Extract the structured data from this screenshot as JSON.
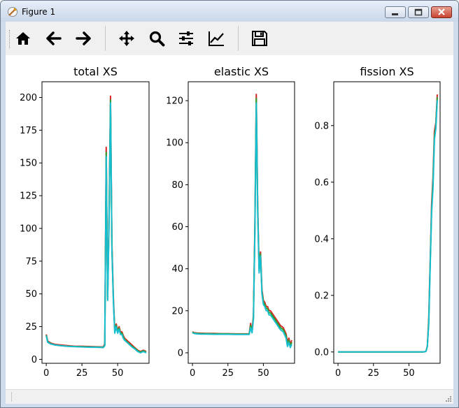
{
  "window": {
    "title": "Figure 1"
  },
  "toolbar": {
    "buttons": [
      {
        "name": "home-button",
        "icon": "home-icon"
      },
      {
        "name": "back-button",
        "icon": "arrow-left-icon"
      },
      {
        "name": "forward-button",
        "icon": "arrow-right-icon"
      },
      {
        "name": "pan-button",
        "icon": "move-icon"
      },
      {
        "name": "zoom-button",
        "icon": "magnifier-icon"
      },
      {
        "name": "configure-subplots-button",
        "icon": "sliders-icon"
      },
      {
        "name": "edit-axes-button",
        "icon": "line-chart-icon"
      },
      {
        "name": "save-button",
        "icon": "floppy-disk-icon"
      }
    ]
  },
  "chart_data": [
    {
      "type": "line",
      "title": "total XS",
      "xlabel": "",
      "ylabel": "",
      "xlim": [
        -3,
        72
      ],
      "ylim": [
        -3,
        212
      ],
      "xticks": [
        0,
        25,
        50
      ],
      "yticks": [
        0,
        25,
        50,
        75,
        100,
        125,
        150,
        175,
        200
      ],
      "grid": false,
      "series": [
        {
          "color": "#d62728",
          "x": [
            0,
            1,
            3,
            6,
            10,
            15,
            20,
            25,
            30,
            35,
            40,
            41,
            42,
            43,
            44,
            45,
            46,
            47,
            48,
            49,
            50,
            51,
            52,
            53,
            54,
            55,
            56,
            57,
            58,
            60,
            62,
            64,
            66,
            68,
            70
          ],
          "y": [
            19,
            14,
            12.5,
            11.5,
            11,
            10.5,
            10,
            10,
            9.8,
            9.6,
            9.5,
            12,
            162,
            48,
            110,
            201,
            88,
            48,
            22,
            27,
            22,
            25,
            21,
            21,
            18,
            16,
            15,
            14,
            13,
            11,
            9,
            7,
            6,
            7,
            6
          ]
        },
        {
          "color": "#2ca02c",
          "x": [
            0,
            1,
            3,
            6,
            10,
            15,
            20,
            25,
            30,
            35,
            40,
            41,
            42,
            43,
            44,
            45,
            46,
            47,
            48,
            49,
            50,
            51,
            52,
            53,
            54,
            55,
            56,
            57,
            58,
            60,
            62,
            64,
            66,
            68,
            70
          ],
          "y": [
            18.5,
            13.5,
            12,
            11,
            10.5,
            10,
            9.8,
            9.7,
            9.5,
            9.4,
            9.2,
            11,
            158,
            46,
            106,
            198,
            85,
            46,
            21,
            26,
            21,
            24,
            20,
            20,
            17,
            15,
            14,
            13,
            12,
            10,
            8.5,
            6.5,
            5.5,
            6.5,
            5.5
          ]
        },
        {
          "color": "#17becf",
          "x": [
            0,
            1,
            3,
            6,
            10,
            15,
            20,
            25,
            30,
            35,
            40,
            41,
            42,
            43,
            44,
            45,
            46,
            47,
            48,
            49,
            50,
            51,
            52,
            53,
            54,
            55,
            56,
            57,
            58,
            60,
            62,
            64,
            66,
            68,
            70
          ],
          "y": [
            18,
            13,
            11.8,
            11,
            10.5,
            10,
            9.7,
            9.5,
            9.3,
            9.2,
            9,
            10.5,
            155,
            45,
            104,
            196,
            84,
            45,
            20,
            25,
            20,
            23,
            19,
            19,
            16,
            14.5,
            13.5,
            12.5,
            11.5,
            9.5,
            8,
            6,
            5,
            6,
            5
          ]
        }
      ]
    },
    {
      "type": "line",
      "title": "elastic XS",
      "xlabel": "",
      "ylabel": "",
      "xlim": [
        -3,
        72
      ],
      "ylim": [
        -5,
        129
      ],
      "xticks": [
        0,
        25,
        50
      ],
      "yticks": [
        0,
        20,
        40,
        60,
        80,
        100,
        120
      ],
      "grid": false,
      "series": [
        {
          "color": "#d62728",
          "x": [
            0,
            1,
            3,
            6,
            10,
            15,
            20,
            25,
            30,
            35,
            40,
            41,
            42,
            43,
            44,
            45,
            46,
            47,
            48,
            49,
            50,
            51,
            52,
            53,
            54,
            55,
            56,
            57,
            58,
            60,
            62,
            64,
            66,
            67,
            68,
            69,
            70
          ],
          "y": [
            10,
            9.6,
            9.4,
            9.3,
            9.2,
            9.2,
            9.1,
            9.1,
            9,
            9,
            9,
            14,
            10,
            18,
            60,
            123,
            70,
            40,
            48,
            30,
            25,
            24,
            22,
            22,
            20,
            20,
            19,
            18,
            17,
            15,
            13,
            12,
            9,
            5,
            7,
            4,
            6
          ]
        },
        {
          "color": "#2ca02c",
          "x": [
            0,
            1,
            3,
            6,
            10,
            15,
            20,
            25,
            30,
            35,
            40,
            41,
            42,
            43,
            44,
            45,
            46,
            47,
            48,
            49,
            50,
            51,
            52,
            53,
            54,
            55,
            56,
            57,
            58,
            60,
            62,
            64,
            66,
            67,
            68,
            69,
            70
          ],
          "y": [
            9.8,
            9.4,
            9.2,
            9.1,
            9.1,
            9,
            9,
            9,
            8.9,
            8.9,
            8.9,
            13,
            9.8,
            17,
            58,
            121,
            68,
            39,
            47,
            29,
            24,
            23,
            21,
            21,
            19,
            19,
            18,
            17,
            16,
            14,
            12,
            11,
            8,
            4,
            6,
            3,
            5
          ]
        },
        {
          "color": "#17becf",
          "x": [
            0,
            1,
            3,
            6,
            10,
            15,
            20,
            25,
            30,
            35,
            40,
            41,
            42,
            43,
            44,
            45,
            46,
            47,
            48,
            49,
            50,
            51,
            52,
            53,
            54,
            55,
            56,
            57,
            58,
            60,
            62,
            64,
            66,
            67,
            68,
            69,
            70
          ],
          "y": [
            9.6,
            9.2,
            9,
            8.9,
            8.9,
            8.8,
            8.8,
            8.8,
            8.7,
            8.7,
            8.7,
            12,
            9.5,
            16,
            56,
            119,
            66,
            38,
            46,
            28,
            23,
            22,
            20,
            20,
            18,
            18,
            17,
            16,
            15,
            13,
            11,
            10,
            7,
            3,
            5,
            2.5,
            4
          ]
        }
      ]
    },
    {
      "type": "line",
      "title": "fission XS",
      "xlabel": "",
      "ylabel": "",
      "xlim": [
        -3,
        72
      ],
      "ylim": [
        -0.04,
        0.955
      ],
      "xticks": [
        0,
        25,
        50
      ],
      "yticks": [
        0.0,
        0.2,
        0.4,
        0.6,
        0.8
      ],
      "grid": false,
      "series": [
        {
          "color": "#d62728",
          "x": [
            0,
            10,
            20,
            30,
            40,
            50,
            60,
            62,
            63,
            64,
            65,
            66,
            67,
            68,
            69,
            70
          ],
          "y": [
            0,
            0,
            0,
            0,
            0,
            0,
            0,
            0.002,
            0.02,
            0.12,
            0.32,
            0.52,
            0.62,
            0.78,
            0.81,
            0.91
          ]
        },
        {
          "color": "#2ca02c",
          "x": [
            0,
            10,
            20,
            30,
            40,
            50,
            60,
            62,
            63,
            64,
            65,
            66,
            67,
            68,
            69,
            70
          ],
          "y": [
            0,
            0,
            0,
            0,
            0,
            0,
            0,
            0.002,
            0.02,
            0.11,
            0.31,
            0.5,
            0.6,
            0.76,
            0.8,
            0.9
          ]
        },
        {
          "color": "#17becf",
          "x": [
            0,
            10,
            20,
            30,
            40,
            50,
            60,
            62,
            63,
            64,
            65,
            66,
            67,
            68,
            69,
            70
          ],
          "y": [
            0,
            0,
            0,
            0,
            0,
            0,
            0,
            0.002,
            0.018,
            0.1,
            0.3,
            0.49,
            0.58,
            0.75,
            0.79,
            0.89
          ]
        }
      ]
    }
  ]
}
